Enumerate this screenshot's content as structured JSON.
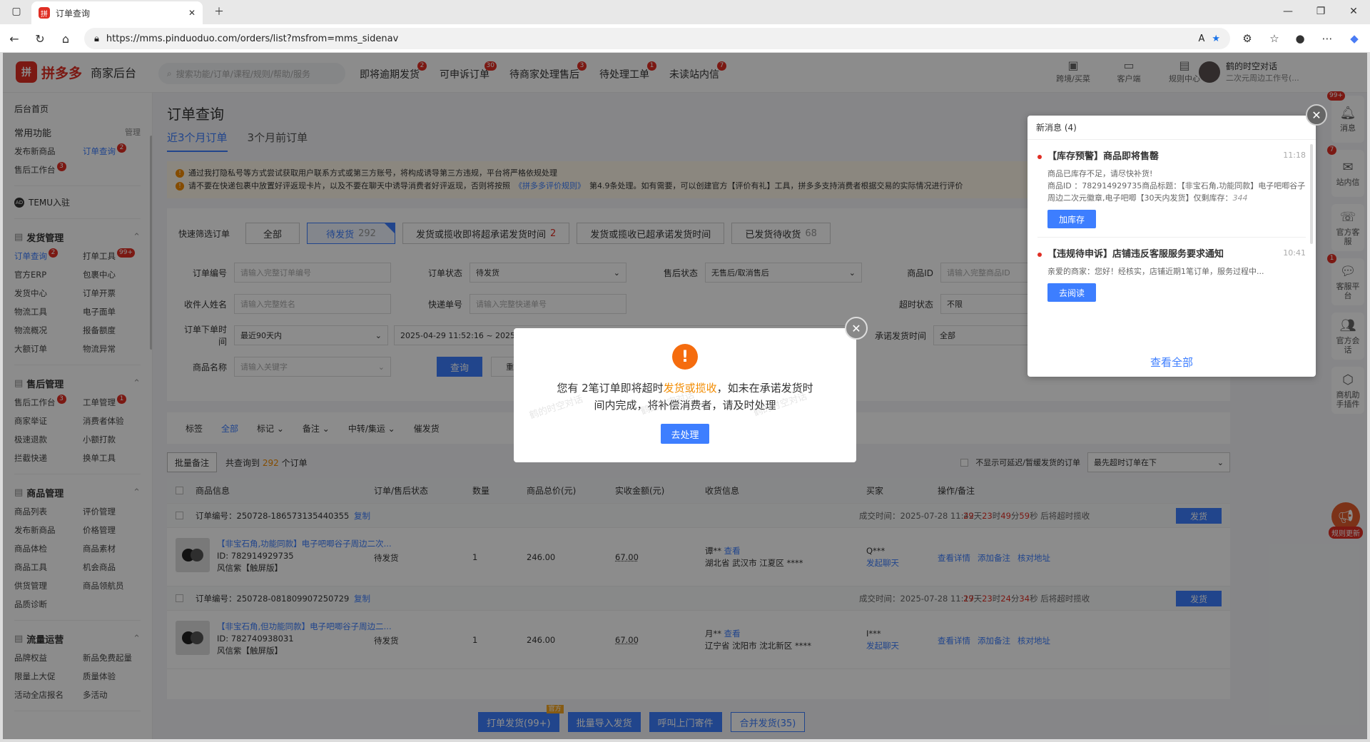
{
  "browser": {
    "tab_title": "订单查询",
    "url": "https://mms.pinduoduo.com/orders/list?msfrom=mms_sidenav"
  },
  "header": {
    "logo_mark": "拼",
    "logo_name": "拼多多",
    "logo_sub": "商家后台",
    "search_placeholder": "搜索功能/订单/课程/规则/帮助/服务",
    "nav": [
      {
        "label": "即将逾期发货",
        "badge": "2"
      },
      {
        "label": "可申诉订单",
        "badge": "30"
      },
      {
        "label": "待商家处理售后",
        "badge": "3"
      },
      {
        "label": "待处理工单",
        "badge": "1"
      },
      {
        "label": "未读站内信",
        "badge": "7"
      }
    ],
    "tools": [
      "跨境/买菜",
      "客户端",
      "规则中心"
    ],
    "user_name": "鹤的时空对话",
    "user_sub": "二次元周边工作号(..."
  },
  "sidebar": {
    "home": "后台首页",
    "common_title": "常用功能",
    "common_manage": "管理",
    "common_items": [
      {
        "label": "发布新商品",
        "badge": "",
        "active": false
      },
      {
        "label": "订单查询",
        "badge": "2",
        "active": true
      },
      {
        "label": "售后工作台",
        "badge": "3",
        "active": false
      }
    ],
    "temu": "TEMU入驻",
    "sections": [
      {
        "title": "发货管理",
        "items": [
          {
            "label": "订单查询",
            "badge": "2",
            "active": true
          },
          {
            "label": "打单工具",
            "badge": "99+",
            "active": false
          },
          {
            "label": "官方ERP",
            "badge": "",
            "active": false
          },
          {
            "label": "包裹中心",
            "badge": "",
            "active": false
          },
          {
            "label": "发货中心",
            "badge": "",
            "active": false
          },
          {
            "label": "订单开票",
            "badge": "",
            "active": false
          },
          {
            "label": "物流工具",
            "badge": "",
            "active": false
          },
          {
            "label": "电子面单",
            "badge": "",
            "active": false
          },
          {
            "label": "物流概况",
            "badge": "",
            "active": false
          },
          {
            "label": "报备额度",
            "badge": "",
            "active": false
          },
          {
            "label": "大额订单",
            "badge": "",
            "active": false
          },
          {
            "label": "物流异常",
            "badge": "",
            "active": false
          }
        ]
      },
      {
        "title": "售后管理",
        "items": [
          {
            "label": "售后工作台",
            "badge": "3",
            "active": false
          },
          {
            "label": "工单管理",
            "badge": "1",
            "active": false
          },
          {
            "label": "商家举证",
            "badge": "",
            "active": false
          },
          {
            "label": "消费者体验",
            "badge": "",
            "active": false
          },
          {
            "label": "极速退款",
            "badge": "",
            "active": false
          },
          {
            "label": "小额打款",
            "badge": "",
            "active": false
          },
          {
            "label": "拦截快递",
            "badge": "",
            "active": false
          },
          {
            "label": "换单工具",
            "badge": "",
            "active": false
          }
        ]
      },
      {
        "title": "商品管理",
        "items": [
          {
            "label": "商品列表",
            "badge": "",
            "active": false
          },
          {
            "label": "评价管理",
            "badge": "",
            "active": false
          },
          {
            "label": "发布新商品",
            "badge": "",
            "active": false
          },
          {
            "label": "价格管理",
            "badge": "",
            "active": false
          },
          {
            "label": "商品体检",
            "badge": "",
            "active": false
          },
          {
            "label": "商品素材",
            "badge": "",
            "active": false
          },
          {
            "label": "商品工具",
            "badge": "",
            "active": false
          },
          {
            "label": "机会商品",
            "badge": "",
            "active": false
          },
          {
            "label": "供货管理",
            "badge": "",
            "active": false
          },
          {
            "label": "商品领航员",
            "badge": "",
            "active": false
          },
          {
            "label": "品质诊断",
            "badge": "",
            "active": false
          }
        ]
      },
      {
        "title": "流量运营",
        "items": [
          {
            "label": "品牌权益",
            "badge": "",
            "active": false
          },
          {
            "label": "新品免费起量",
            "badge": "",
            "active": false
          },
          {
            "label": "限量上大促",
            "badge": "",
            "active": false
          },
          {
            "label": "质量体验",
            "badge": "",
            "active": false
          },
          {
            "label": "活动全店报名",
            "badge": "",
            "active": false
          },
          {
            "label": "多活动",
            "badge": "",
            "active": false
          }
        ]
      }
    ]
  },
  "page": {
    "title": "订单查询",
    "tabs": [
      {
        "label": "近3个月订单",
        "active": true
      },
      {
        "label": "3个月前订单",
        "active": false
      }
    ],
    "warnings": [
      {
        "text": "通过我打隐私号等方式尝试获取用户联系方式或第三方账号，将构成诱导第三方违规，平台将严格依规处理",
        "link": "",
        "tail": ""
      },
      {
        "text": "请不要在快递包裹中放置好评返现卡片，以及不要在聊天中诱导消费者好评返现，否则将按照",
        "link": "《拼多多评价规则》",
        "tail": "第4.9条处理。如有需要，可以创建官方【评价有礼】工具，拼多多支持消费者根据交易的实际情况进行评价"
      }
    ]
  },
  "quick_filter": {
    "label": "快速筛选订单",
    "all": "全部",
    "pending_label": "待发货",
    "pending_count": "292",
    "soon_label": "发货或揽收即将超承诺发货时间",
    "soon_count": "2",
    "over_label": "发货或揽收已超承诺发货时间",
    "shipped_label": "已发货待收货",
    "shipped_count": "68"
  },
  "filters": {
    "order_no_label": "订单编号",
    "order_no_ph": "请输入完整订单编号",
    "status_label": "订单状态",
    "status_value": "待发货",
    "after_label": "售后状态",
    "after_value": "无售后/取消售后",
    "pid_label": "商品ID",
    "pid_ph": "请输入完整商品ID",
    "recv_label": "收件人姓名",
    "recv_ph": "请输入完整姓名",
    "express_label": "快递单号",
    "express_ph": "请输入完整快递单号",
    "timeout_label": "超时状态",
    "timeout_value": "不限",
    "time_label": "订单下单时间",
    "time_range": "最近90天内",
    "time_value": "2025-04-29 11:52:16 ~ 2025-07-28 11:52:16",
    "promise_label": "承诺发货时间",
    "promise_value": "全部",
    "goods_label": "商品名称",
    "goods_ph": "请输入关键字",
    "query": "查询",
    "reset": "重置"
  },
  "tagbar": [
    "标签",
    "全部",
    "标记",
    "备注",
    "中转/集运",
    "催发货"
  ],
  "actions": {
    "batch_note": "批量备注",
    "total_prefix": "共查询到",
    "total": "292",
    "total_suffix": "个订单",
    "hide_delay": "不显示可延迟/暂缓发货的订单",
    "sort": "最先超时订单在下"
  },
  "table": {
    "headers": [
      "商品信息",
      "订单/售后状态",
      "数量",
      "商品总价(元)",
      "实收金额(元)",
      "收货信息",
      "买家",
      "操作/备注"
    ],
    "orders": [
      {
        "order_no": "订单编号：250728-186573135440355",
        "copy": "复制",
        "deal_time": "成交时间：2025-07-28 11:42",
        "countdown_d": "29",
        "countdown_h": "23",
        "countdown_m": "49",
        "countdown_s": "59",
        "countdown_tail": "秒 后将超时揽收",
        "ship": "发货",
        "title": "【非宝石角,功能同款】电子吧唧谷子周边二次...",
        "pid": "ID: 782914929735",
        "spec": "风信紫【触屏版】",
        "status": "待发货",
        "qty": "1",
        "total": "246.00",
        "paid": "67.00",
        "recv_name": "谭**",
        "recv_view": "查看",
        "recv_addr": "湖北省 武汉市 江夏区 ****",
        "buyer": "Q***",
        "chat": "发起聊天",
        "ops": [
          "查看详情",
          "添加备注",
          "核对地址"
        ]
      },
      {
        "order_no": "订单编号：250728-081809907250729",
        "copy": "复制",
        "deal_time": "成交时间：2025-07-28 11:17",
        "countdown_d": "29",
        "countdown_h": "23",
        "countdown_m": "24",
        "countdown_s": "34",
        "countdown_tail": "秒 后将超时揽收",
        "ship": "发货",
        "title": "【非宝石角,但功能同款】电子吧唧谷子周边二...",
        "pid": "ID: 782740938031",
        "spec": "风信紫【触屏版】",
        "status": "待发货",
        "qty": "1",
        "total": "246.00",
        "paid": "67.00",
        "recv_name": "月**",
        "recv_view": "查看",
        "recv_addr": "辽宁省 沈阳市 沈北新区 ****",
        "buyer": "I***",
        "chat": "发起聊天",
        "ops": [
          "查看详情",
          "添加备注",
          "核对地址"
        ]
      }
    ]
  },
  "bottom_actions": {
    "print": "打单发货(99+)",
    "print_tag": "官方",
    "batch_import": "批量导入发货",
    "call_pickup": "呼叫上门寄件",
    "merge": "合并发货(35)"
  },
  "rail": [
    {
      "label": "消息",
      "badge": "99+",
      "icon": "bell-icon"
    },
    {
      "label": "站内信",
      "badge": "7",
      "icon": "mail-icon"
    },
    {
      "label": "官方客服",
      "badge": "",
      "icon": "headset-icon"
    },
    {
      "label": "客服平台",
      "badge": "1",
      "icon": "chat-icon"
    },
    {
      "label": "官方会话",
      "badge": "",
      "icon": "people-icon"
    },
    {
      "label": "商机助手插件",
      "badge": "",
      "icon": "plugin-icon"
    }
  ],
  "megaphone_label": "规则更新",
  "notifications": {
    "header": "新消息 (4)",
    "items": [
      {
        "title": "【库存预警】商品即将售罄",
        "time": "11:18",
        "body1": "商品已库存不足，请尽快补货!",
        "body2": "商品ID ：782914929735商品标题：【非宝石角,功能同款】电子吧唧谷子周边二次元徽章,电子吧唧【30天内发货】仅剩库存：",
        "body_num": "344",
        "button": "加库存"
      },
      {
        "title": "【违规待申诉】店铺违反客服服务要求通知",
        "time": "10:41",
        "body1": "亲爱的商家：您好！经核实，店铺近期1笔订单，服务过程中...",
        "body2": "",
        "body_num": "",
        "button": "去阅读"
      }
    ],
    "more": "查看全部"
  },
  "modal": {
    "icon": "!",
    "text_a": "您有 2笔订单即将超时",
    "text_hl": "发货或揽收",
    "text_b": "，如未在承诺发货时间内完成，将补偿消费者，请及时处理",
    "button": "去处理",
    "watermark": "鹤的时空对话"
  },
  "colors": {
    "brand": "#e02e24",
    "accent": "#3d7eff",
    "warn": "#f28b00"
  }
}
